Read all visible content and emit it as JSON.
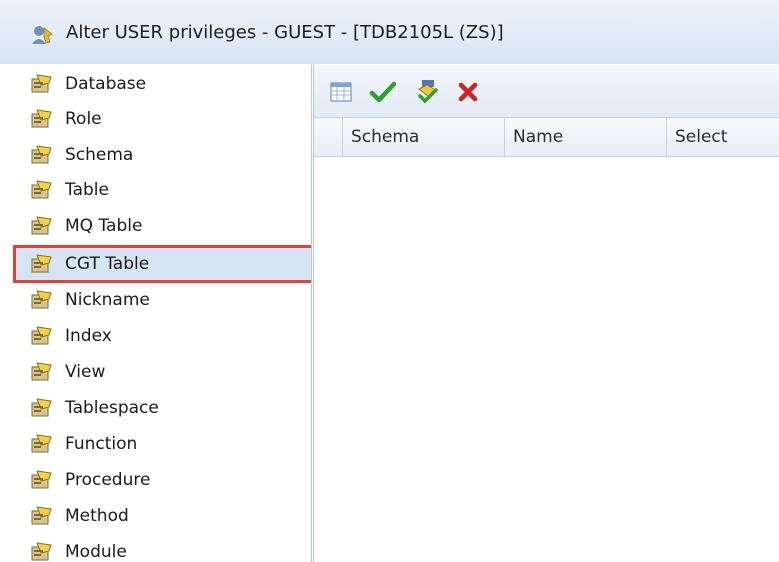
{
  "window": {
    "title": "Alter USER privileges - GUEST - [TDB2105L (ZS)]"
  },
  "sidebar": {
    "items": [
      {
        "label": "Database",
        "icon": "privilege-key-icon"
      },
      {
        "label": "Role",
        "icon": "privilege-key-icon"
      },
      {
        "label": "Schema",
        "icon": "privilege-key-icon"
      },
      {
        "label": "Table",
        "icon": "privilege-key-icon"
      },
      {
        "label": "MQ Table",
        "icon": "privilege-key-icon"
      },
      {
        "label": "CGT Table",
        "icon": "privilege-key-icon",
        "selected": true
      },
      {
        "label": "Nickname",
        "icon": "privilege-key-icon"
      },
      {
        "label": "Index",
        "icon": "privilege-key-icon"
      },
      {
        "label": "View",
        "icon": "privilege-key-icon"
      },
      {
        "label": "Tablespace",
        "icon": "privilege-key-icon"
      },
      {
        "label": "Function",
        "icon": "privilege-key-icon"
      },
      {
        "label": "Procedure",
        "icon": "privilege-key-icon"
      },
      {
        "label": "Method",
        "icon": "privilege-key-icon"
      },
      {
        "label": "Module",
        "icon": "privilege-key-icon"
      }
    ]
  },
  "toolbar": {
    "buttons": [
      {
        "icon": "table-grid-icon"
      },
      {
        "icon": "green-check-icon"
      },
      {
        "icon": "grant-all-icon"
      },
      {
        "icon": "red-x-icon"
      }
    ]
  },
  "grid": {
    "columns": [
      "Schema",
      "Name",
      "Select"
    ]
  },
  "colors": {
    "selection_highlight": "#e04338",
    "selection_bg": "#d6e3f1",
    "check": "#2ea12e",
    "delete": "#d42020"
  }
}
